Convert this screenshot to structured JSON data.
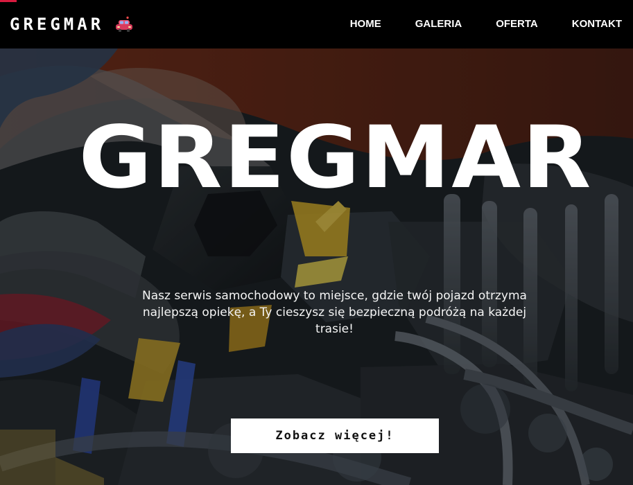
{
  "header": {
    "brand_name": "GREGMAR",
    "brand_icon": "car-icon",
    "accent_color": "#d81b3f",
    "nav": [
      {
        "label": "HOME"
      },
      {
        "label": "GALERIA"
      },
      {
        "label": "OFERTA"
      },
      {
        "label": "KONTAKT"
      }
    ]
  },
  "hero": {
    "title": "GREGMAR",
    "text": "Nasz serwis samochodowy to miejsce, gdzie twój pojazd otrzyma najlepszą opiekę, a Ty cieszysz się bezpieczną podróżą na każdej trasie!",
    "cta_label": "Zobacz więcej!"
  }
}
